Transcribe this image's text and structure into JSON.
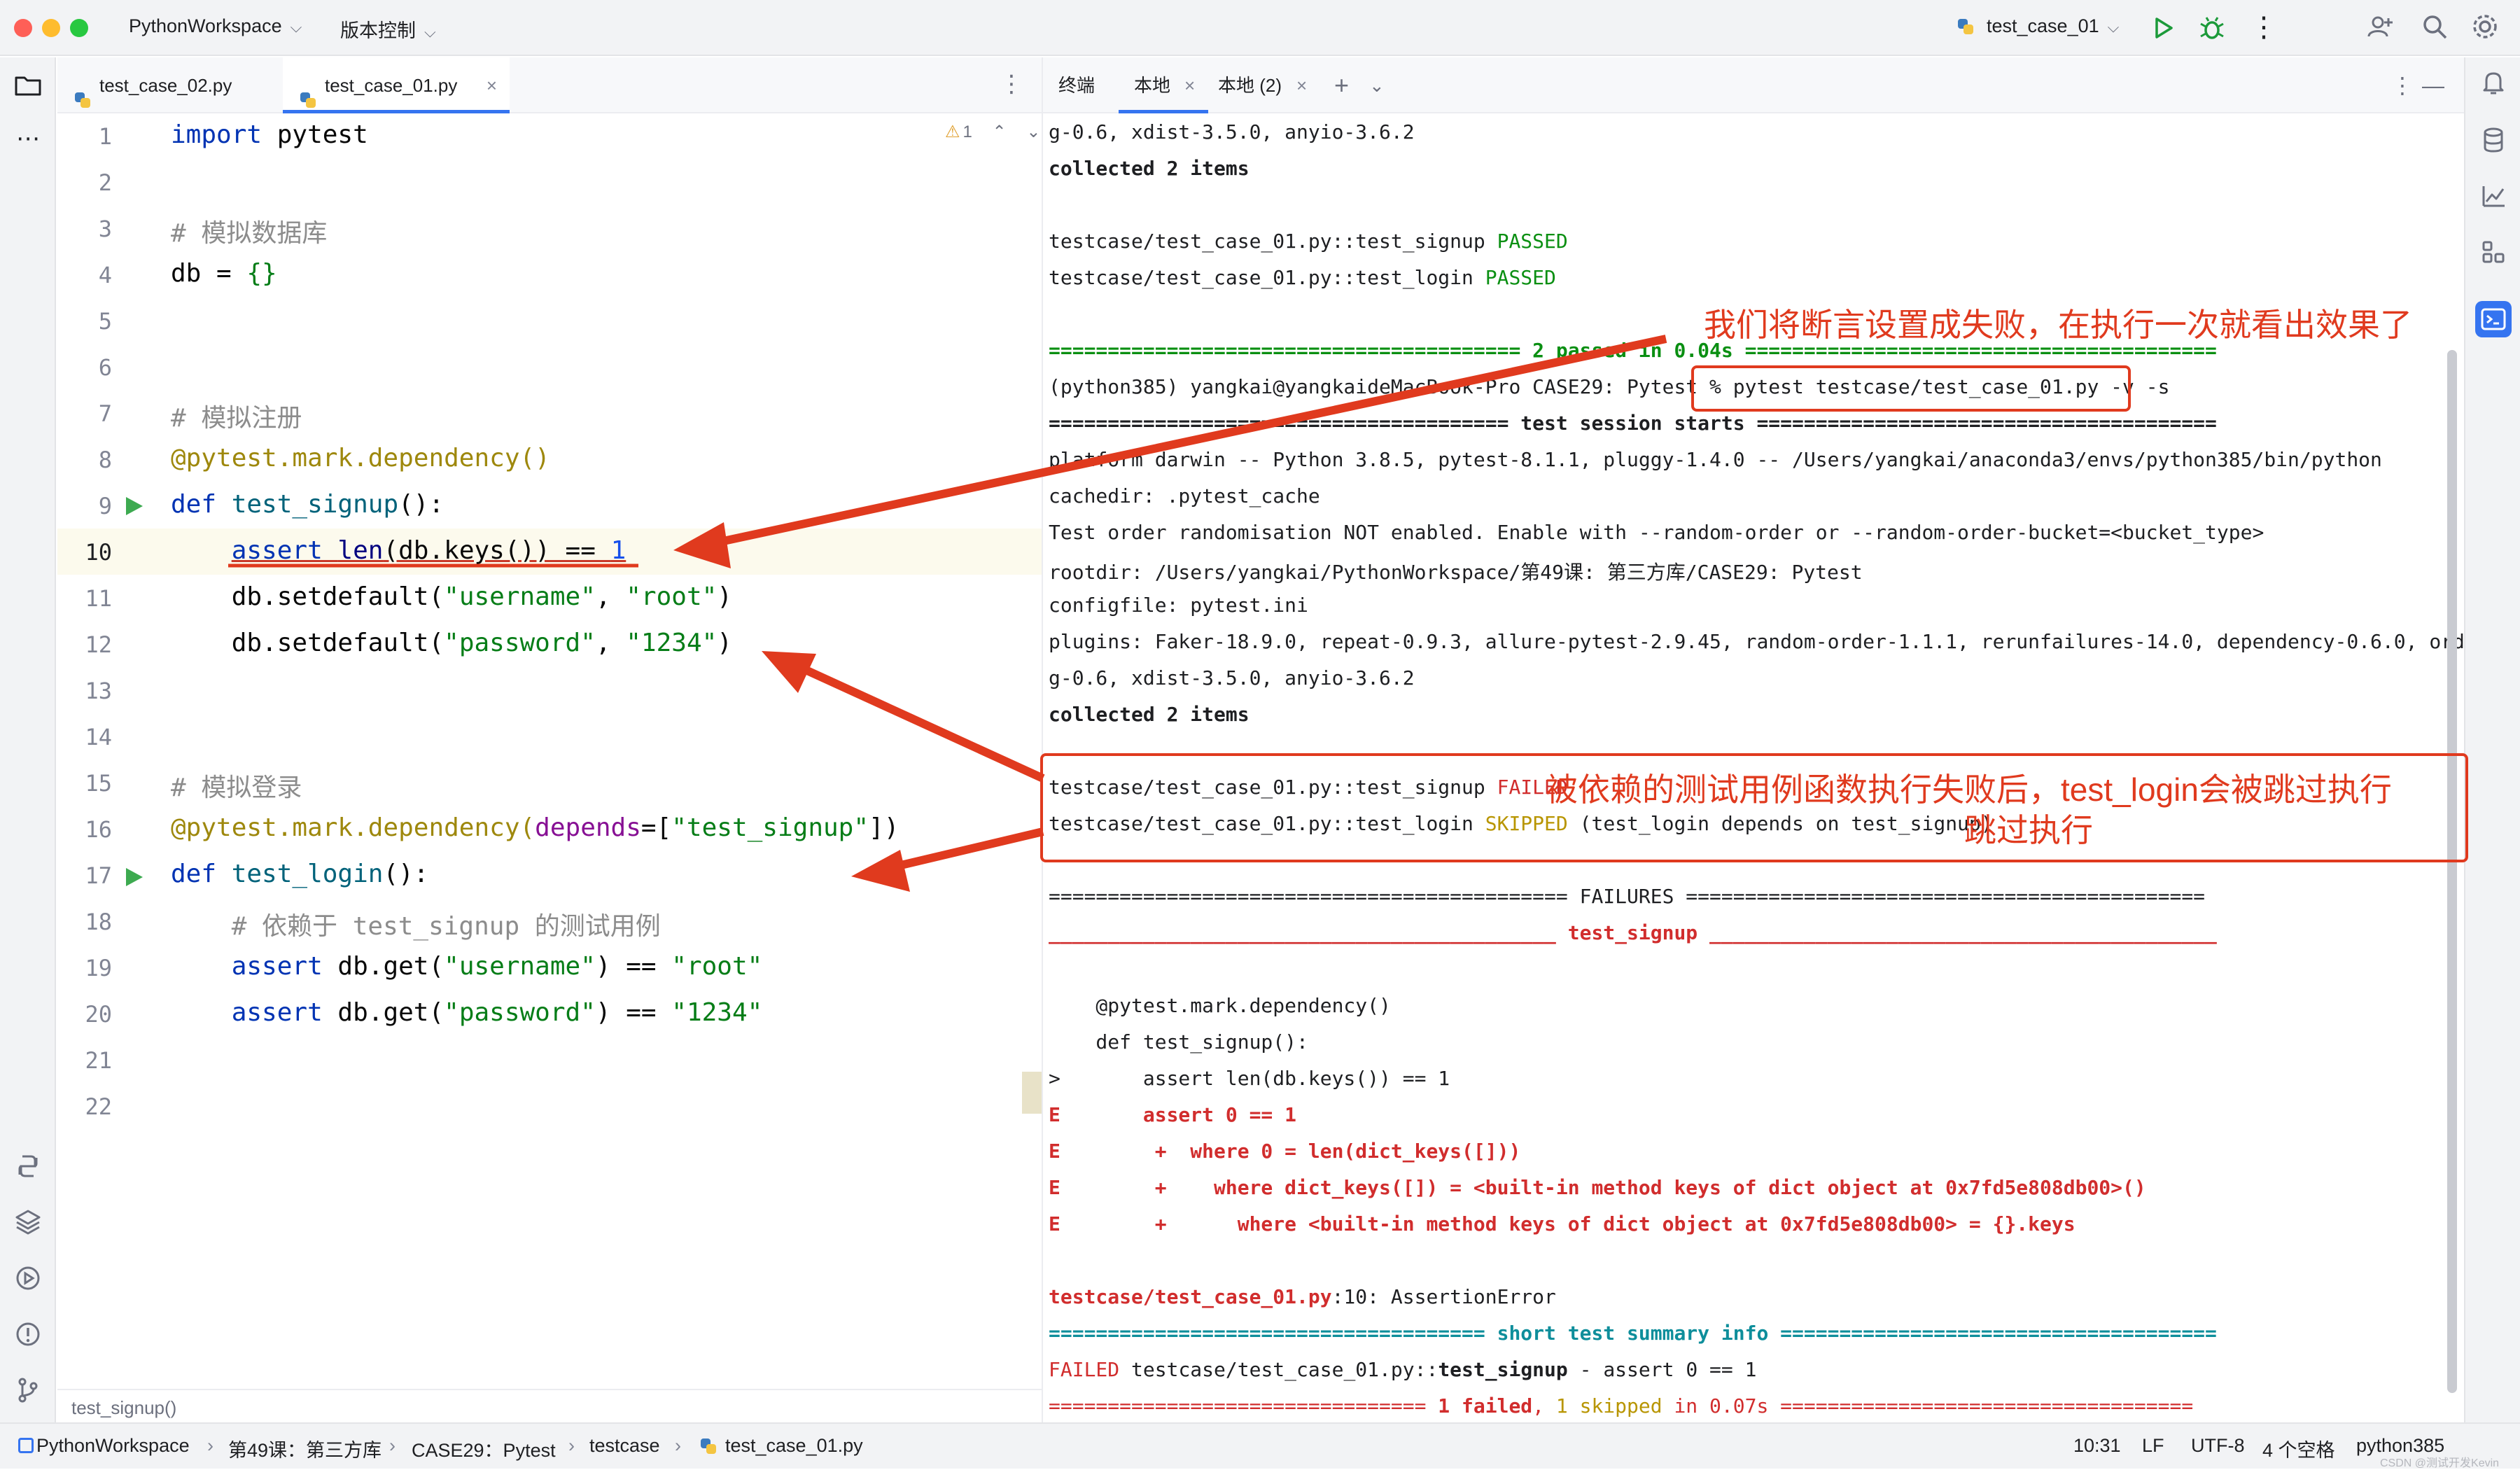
{
  "titlebar": {
    "project": "PythonWorkspace",
    "vcs": "版本控制",
    "run_config": "test_case_01"
  },
  "editor_tabs": [
    {
      "label": "test_case_02.py"
    },
    {
      "label": "test_case_01.py"
    }
  ],
  "editor": {
    "warning_count": "1",
    "line_numbers": [
      "1",
      "2",
      "3",
      "4",
      "5",
      "6",
      "7",
      "8",
      "9",
      "10",
      "11",
      "12",
      "13",
      "14",
      "15",
      "16",
      "17",
      "18",
      "19",
      "20",
      "21",
      "22"
    ],
    "current_line": "10",
    "breadcrumb_hint": "test_signup()"
  },
  "code": {
    "l1a": "import",
    "l1b": " pytest",
    "l3": "# 模拟数据库",
    "l4a": "db = ",
    "l4b": "{}",
    "l7": "# 模拟注册",
    "l8": "@pytest.mark.dependency()",
    "l9a": "def ",
    "l9b": "test_signup",
    "l9c": "():",
    "l10a": "    ",
    "l10b": "assert ",
    "l10c": "len",
    "l10d": "(db.keys()) == ",
    "l10e": "1",
    "l11a": "    db.setdefault(",
    "l11b": "\"username\"",
    "l11c": ", ",
    "l11d": "\"root\"",
    "l11e": ")",
    "l12a": "    db.setdefault(",
    "l12b": "\"password\"",
    "l12c": ", ",
    "l12d": "\"1234\"",
    "l12e": ")",
    "l15": "# 模拟登录",
    "l16a": "@pytest.mark.dependency(",
    "l16b": "depends",
    "l16c": "=[",
    "l16d": "\"test_signup\"",
    "l16e": "])",
    "l17a": "def ",
    "l17b": "test_login",
    "l17c": "():",
    "l18": "    # 依赖于 test_signup 的测试用例",
    "l19a": "    ",
    "l19b": "assert ",
    "l19c": "db.get(",
    "l19d": "\"username\"",
    "l19e": ") == ",
    "l19f": "\"root\"",
    "l20a": "    ",
    "l20b": "assert ",
    "l20c": "db.get(",
    "l20d": "\"password\"",
    "l20e": ") == ",
    "l20f": "\"1234\""
  },
  "terminal_tabs": {
    "title": "终端",
    "tab1": "本地",
    "tab2": "本地 (2)"
  },
  "terminal": {
    "t1": "g-0.6, xdist-3.5.0, anyio-3.6.2",
    "t2": "collected 2 items",
    "t3a": "testcase/test_case_01.py::test_signup ",
    "t3b": "PASSED",
    "t4a": "testcase/test_case_01.py::test_login ",
    "t4b": "PASSED",
    "t5": "======================================== 2 passed in 0.04s ========================================",
    "t6a": "(python385) yangkai@yangkaideMacBook-Pro CASE29: Pytest % ",
    "t6b": "pytest testcase/test_case_01.py -v -s",
    "t7": "======================================= test session starts =======================================",
    "t8": "platform darwin -- Python 3.8.5, pytest-8.1.1, pluggy-1.4.0 -- /Users/yangkai/anaconda3/envs/python385/bin/python",
    "t9": "cachedir: .pytest_cache",
    "t10": "Test order randomisation NOT enabled. Enable with --random-order or --random-order-bucket=<bucket_type>",
    "t11": "rootdir: /Users/yangkai/PythonWorkspace/第49课: 第三方库/CASE29: Pytest",
    "t12": "configfile: pytest.ini",
    "t13": "plugins: Faker-18.9.0, repeat-0.9.3, allure-pytest-2.9.45, random-order-1.1.1, rerunfailures-14.0, dependency-0.6.0, orderin",
    "t14": "g-0.6, xdist-3.5.0, anyio-3.6.2",
    "t15": "collected 2 items",
    "t16a": "testcase/test_case_01.py::test_signup ",
    "t16b": "FAILED",
    "t17a": "testcase/test_case_01.py::test_login ",
    "t17b": "SKIPPED",
    "t17c": " (test_login depends on test_signup)",
    "t18": "============================================ FAILURES ============================================",
    "t19": "___________________________________________ test_signup ___________________________________________",
    "t20": "    @pytest.mark.dependency()",
    "t21": "    def test_signup():",
    "t22": ">       assert len(db.keys()) == 1",
    "t23": "E       assert 0 == 1",
    "t24": "E        +  where 0 = len(dict_keys([]))",
    "t25": "E        +    where dict_keys([]) = <built-in method keys of dict object at 0x7fd5e808db00>()",
    "t26": "E        +      where <built-in method keys of dict object at 0x7fd5e808db00> = {}.keys",
    "t27a": "testcase/test_case_01.py",
    "t27b": ":10: AssertionError",
    "t28": "===================================== short test summary info =====================================",
    "t29a": "FAILED",
    "t29b": " testcase/test_case_01.py::",
    "t29c": "test_signup",
    "t29d": " - assert 0 == 1",
    "t30a": "================================ ",
    "t30b": "1 failed",
    "t30c": ", ",
    "t30d": "1 skipped",
    "t30e": " in 0.07s ==================================="
  },
  "annotations": {
    "a1": "我们将断言设置成失败，在执行一次就看出效果了",
    "a2": "被依赖的测试用例函数执行失败后，test_login会被跳过执行",
    "a3": "跳过执行"
  },
  "statusbar": {
    "crumbs": [
      "PythonWorkspace",
      "第49课：第三方库",
      "CASE29：Pytest",
      "testcase",
      "test_case_01.py"
    ],
    "time": "10:31",
    "lf": "LF",
    "encoding": "UTF-8",
    "indent": "4 个空格",
    "interpreter": "python385",
    "watermark": "CSDN @测试开发Kevin"
  },
  "colors": {
    "accent": "#3574f0",
    "annotation": "#e03a1e",
    "passed": "#0a8f12",
    "failed": "#d12d2d"
  }
}
